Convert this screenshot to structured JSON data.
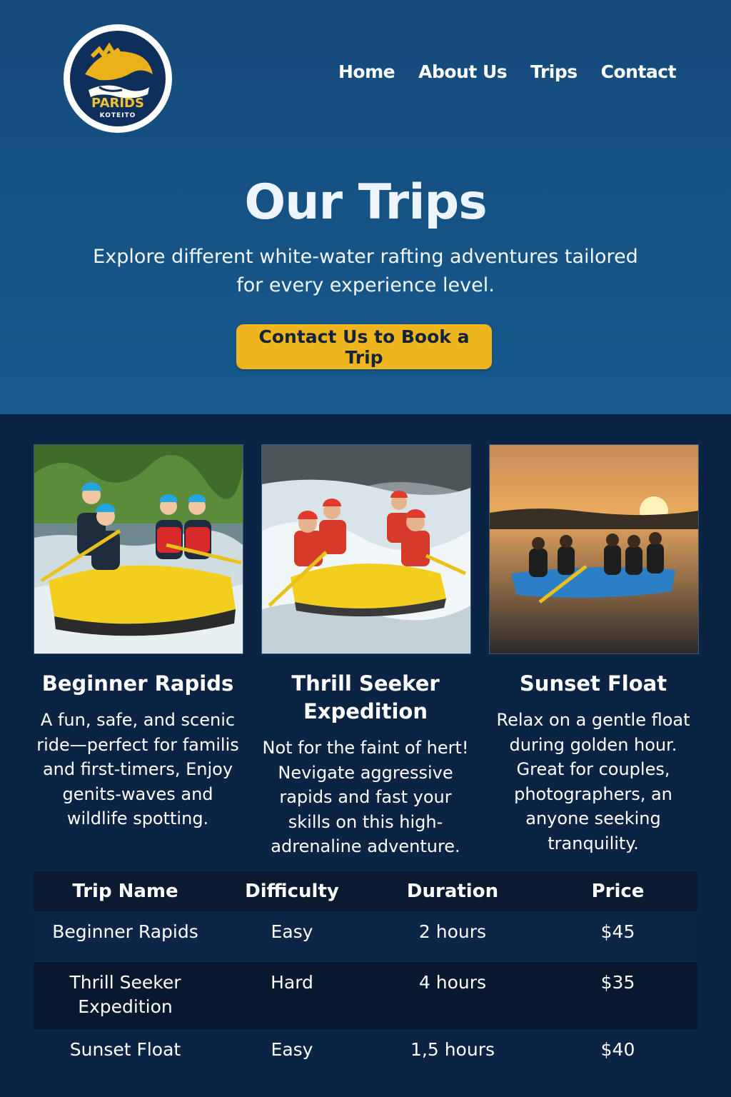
{
  "brand": {
    "name": "PARIDS",
    "tagline": "KOTEITO"
  },
  "nav": {
    "items": [
      "Home",
      "About Us",
      "Trips",
      "Contact"
    ]
  },
  "hero": {
    "title": "Our Trips",
    "subtitle": "Explore different white-water rafting adventures tailored for every experience level.",
    "cta_label": "Contact Us to Book a Trip"
  },
  "trips": [
    {
      "title": "Beginner Rapids",
      "description": "A fun, safe, and scenic ride—perfect for familis and first-timers, Enjoy genits-waves and wildlife spotting.",
      "image": "yellow raft with four rafters in blue helmets"
    },
    {
      "title": "Thrill Seeker Expedition",
      "description": "Not for the faint of hert! Nevigate aggressive rapids and fast your skills on this high-adrenaline adventure.",
      "image": "yellow raft in heavy whitewater with red helmets"
    },
    {
      "title": "Sunset Float",
      "description": "Relax on a gentle float during golden hour. Great for couples, photographers, an anyone seeking tranquility.",
      "image": "blue raft at sunset on calm lake"
    }
  ],
  "table": {
    "headers": [
      "Trip Name",
      "Difficulty",
      "Duration",
      "Price"
    ],
    "rows": [
      [
        "Beginner Rapids",
        "Easy",
        "2 hours",
        "$45"
      ],
      [
        "Thrill Seeker Expedition",
        "Hard",
        "4 hours",
        "$35"
      ],
      [
        "Sunset Float",
        "Easy",
        "1,5 hours",
        "$40"
      ]
    ]
  },
  "colors": {
    "hero_bg": "#175a8e",
    "main_bg": "#0c2444",
    "accent": "#efb51d",
    "table_head": "#091a31"
  }
}
